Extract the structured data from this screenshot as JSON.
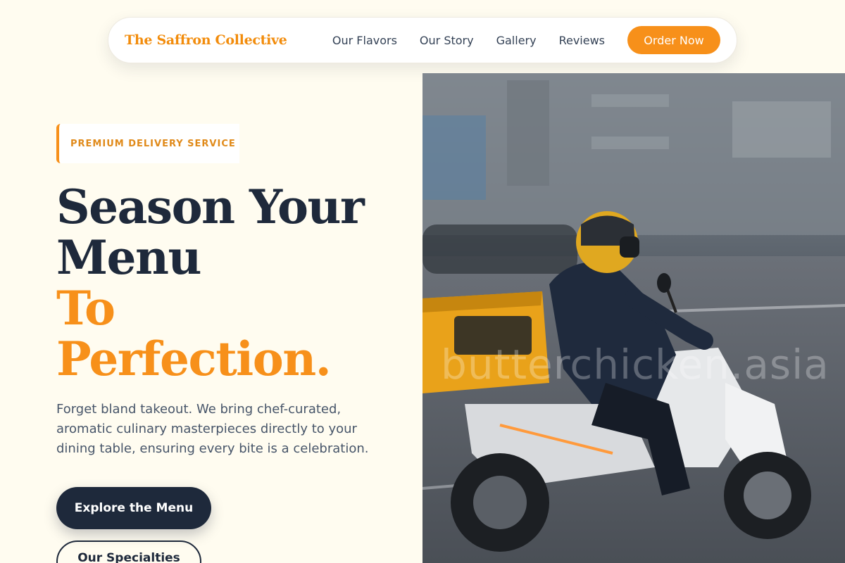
{
  "nav": {
    "brand": "The Saffron Collective",
    "links": [
      "Our Flavors",
      "Our Story",
      "Gallery",
      "Reviews"
    ],
    "cta": "Order Now"
  },
  "hero": {
    "badge": "PREMIUM DELIVERY SERVICE",
    "headline_dark": [
      "Season Your",
      "Menu"
    ],
    "headline_accent": [
      "To",
      "Perfection."
    ],
    "subtext": "Forget bland takeout. We bring chef-curated, aromatic culinary masterpieces directly to your dining table, ensuring every bite is a celebration.",
    "primary_button": "Explore the Menu",
    "secondary_button": "Our Specialties"
  },
  "image": {
    "description_icon": "delivery-scooter-photo",
    "watermark": "butterchicken.asia"
  },
  "colors": {
    "accent": "#f7901a",
    "dark": "#1e293b",
    "background": "#fffcf0"
  }
}
